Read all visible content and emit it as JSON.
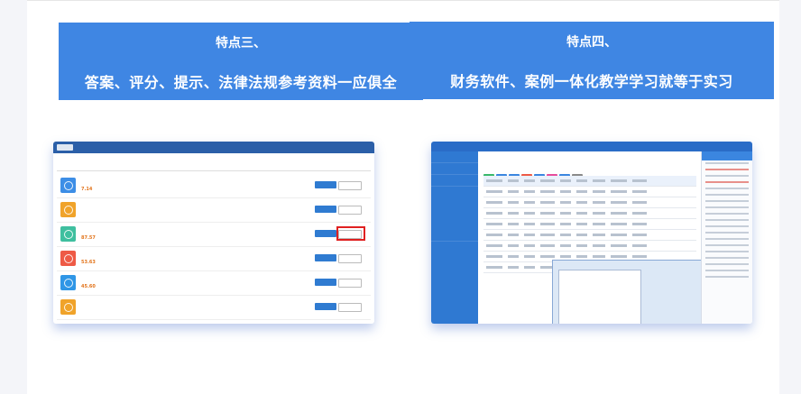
{
  "features": [
    {
      "title": "特点三、",
      "subtitle": "答案、评分、提示、法律法规参考资料一应俱全"
    },
    {
      "title": "特点四、",
      "subtitle": "财务软件、案例一体化教学学习就等于实习"
    }
  ],
  "left_screenshot": {
    "rows": [
      {
        "color": "#3d8ee6",
        "score": "7.14"
      },
      {
        "color": "#f0a32a",
        "score": ""
      },
      {
        "color": "#3fbf9f",
        "score": "87.57"
      },
      {
        "color": "#ee5a46",
        "score": "53.63"
      },
      {
        "color": "#2f96e6",
        "score": "45.60"
      },
      {
        "color": "#f0a32a",
        "score": ""
      }
    ]
  },
  "right_screenshot": {
    "toolbar_colors": [
      "#39b86a",
      "#3b86e0",
      "#3b86e0",
      "#ee5a46",
      "#3b86e0",
      "#e74c9c",
      "#3b86e0",
      "#8a8a8a"
    ]
  }
}
